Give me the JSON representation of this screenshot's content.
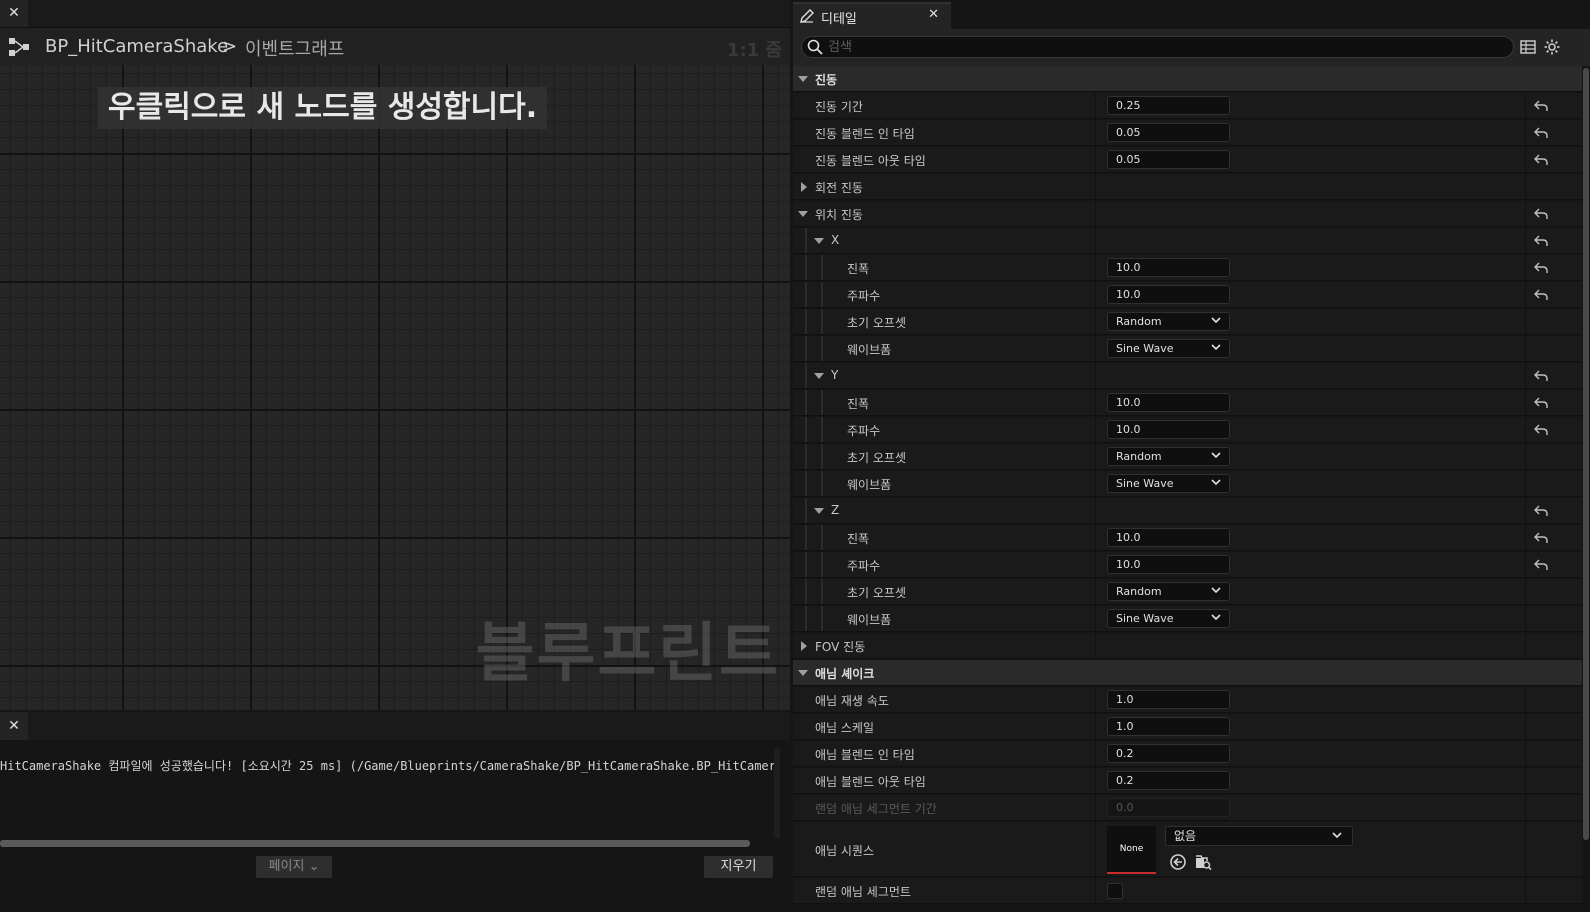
{
  "graph": {
    "breadcrumb_main": "BP_HitCameraShake",
    "breadcrumb_sep": ">",
    "breadcrumb_sub": "이벤트그래프",
    "zoom": "1:1 줌",
    "hint": "우클릭으로 새 노드를 생성합니다.",
    "watermark": "블루프린트"
  },
  "log": {
    "message": "HitCameraShake 컴파일에 성공했습니다! [소요시간 25 ms] (/Game/Blueprints/CameraShake/BP_HitCameraShake.BP_HitCameraSha",
    "page_label": "페이지",
    "clear_label": "지우기"
  },
  "details": {
    "tab_title": "디테일",
    "search_placeholder": "검색",
    "rows": {
      "shake_cat": "진동",
      "duration": {
        "label": "진동 기간",
        "value": "0.25"
      },
      "blend_in": {
        "label": "진동 블렌드 인 타임",
        "value": "0.05"
      },
      "blend_out": {
        "label": "진동 블렌드 아웃 타임",
        "value": "0.05"
      },
      "rot_shake": "회전 진동",
      "loc_shake": "위치 진동",
      "x": "X",
      "y": "Y",
      "z": "Z",
      "amplitude_label": "진폭",
      "frequency_label": "주파수",
      "offset_label": "초기 오프셋",
      "waveform_label": "웨이브폼",
      "x_amp": "10.0",
      "x_freq": "10.0",
      "x_offset": "Random",
      "x_wave": "Sine Wave",
      "y_amp": "10.0",
      "y_freq": "10.0",
      "y_offset": "Random",
      "y_wave": "Sine Wave",
      "z_amp": "10.0",
      "z_freq": "10.0",
      "z_offset": "Random",
      "z_wave": "Sine Wave",
      "fov_shake": "FOV 진동",
      "anim_cat": "애님 셰이크",
      "anim_rate": {
        "label": "애님 재생 속도",
        "value": "1.0"
      },
      "anim_scale": {
        "label": "애님 스케일",
        "value": "1.0"
      },
      "anim_blend_in": {
        "label": "애님 블렌드 인 타임",
        "value": "0.2"
      },
      "anim_blend_out": {
        "label": "애님 블렌드 아웃 타임",
        "value": "0.2"
      },
      "rand_seg_dur": {
        "label": "랜덤 애님 세그먼트 기간",
        "value": "0.0"
      },
      "anim_seq": {
        "label": "애님 시퀀스",
        "thumb": "None",
        "asset": "없음"
      },
      "rand_seg": {
        "label": "랜덤 애님 세그먼트"
      }
    }
  }
}
